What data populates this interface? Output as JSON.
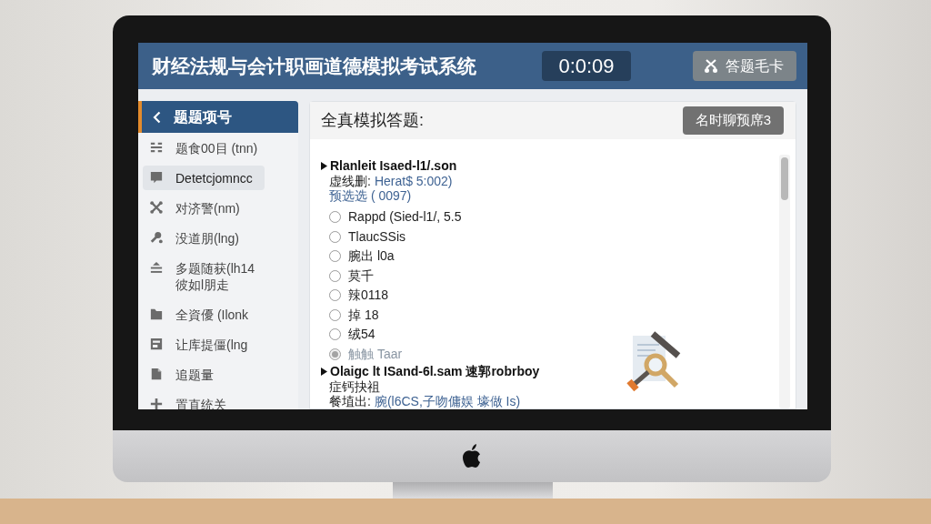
{
  "header": {
    "title": "财经法规与会计职画道德模拟考试系统",
    "timer": "0:0:09",
    "answer_card_button": "答题毛卡"
  },
  "sidebar": {
    "back_button": "题题项号",
    "items": [
      {
        "label": "题食00目 (tnn)",
        "selected": false
      },
      {
        "label": "Detetcjomncc",
        "selected": true
      },
      {
        "label": "对济警(nm)",
        "selected": false
      },
      {
        "label": "没道朋(lng)",
        "selected": false
      },
      {
        "label": "多题随获(lh14\n彼如l朋走",
        "selected": false
      },
      {
        "label": "全資優 (Ilonk",
        "selected": false
      },
      {
        "label": "让库提僵(lng",
        "selected": false
      },
      {
        "label": "追题量",
        "selected": false
      },
      {
        "label": "置直统关",
        "selected": false
      }
    ]
  },
  "panel": {
    "title": "全真模拟答题:",
    "button": "名时聊预席3",
    "questions": [
      {
        "title": "Rlanleit Isaed-l1/.son",
        "lines": [
          {
            "kind": "field",
            "label": "虚线删:",
            "value": "Herat$ 5:002)"
          },
          {
            "kind": "note",
            "text": "预选选 ( 0097)"
          }
        ],
        "options": [
          {
            "label": "Rappd (Sied-l1/, 5.5",
            "selected": false
          },
          {
            "label": "TlaucSSis",
            "selected": false
          },
          {
            "label": "腕出 l0a",
            "selected": false
          },
          {
            "label": "莫千",
            "selected": false
          },
          {
            "label": "辣0118",
            "selected": false
          },
          {
            "label": "掉 18",
            "selected": false
          },
          {
            "label": "绒54",
            "selected": false
          },
          {
            "label": "触触 Taar",
            "selected": true
          }
        ]
      },
      {
        "title": "Olaigc lt ISand-6l.sam 速郭robrboy",
        "lines": [
          {
            "kind": "plain",
            "text": "症钙抉祖"
          },
          {
            "kind": "field",
            "label": "餐埴出:",
            "value": "腕(l6CS,子吻傭娱 壕做 Is)"
          }
        ]
      }
    ]
  }
}
